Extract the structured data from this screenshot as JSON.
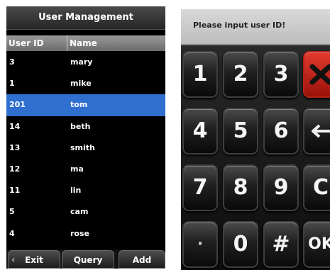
{
  "user_management": {
    "title": "User Management",
    "columns": {
      "id": "User ID",
      "name": "Name"
    },
    "rows": [
      {
        "id": "3",
        "name": "mary"
      },
      {
        "id": "1",
        "name": "mike"
      },
      {
        "id": "201",
        "name": "tom"
      },
      {
        "id": "14",
        "name": "beth"
      },
      {
        "id": "13",
        "name": "smith"
      },
      {
        "id": "12",
        "name": "ma"
      },
      {
        "id": "11",
        "name": "lin"
      },
      {
        "id": "5",
        "name": "cam"
      },
      {
        "id": "4",
        "name": "rose"
      }
    ],
    "selected_row_id": "201",
    "buttons": {
      "exit": "Exit",
      "query": "Query",
      "add": "Add"
    }
  },
  "keypad": {
    "prompt": "Please input user ID!",
    "keys": {
      "k1": "1",
      "k2": "2",
      "k3": "3",
      "k4": "4",
      "k5": "5",
      "k6": "6",
      "k7": "7",
      "k8": "8",
      "k9": "9",
      "kdot": "·",
      "k0": "0",
      "khash": "#",
      "kclear": "C",
      "kok": "OK"
    },
    "icons": {
      "delete": "x-icon",
      "backspace": "backspace-arrow-icon"
    },
    "colors": {
      "delete_key": "#c8201a",
      "selected_row": "#2f6fd0"
    }
  }
}
